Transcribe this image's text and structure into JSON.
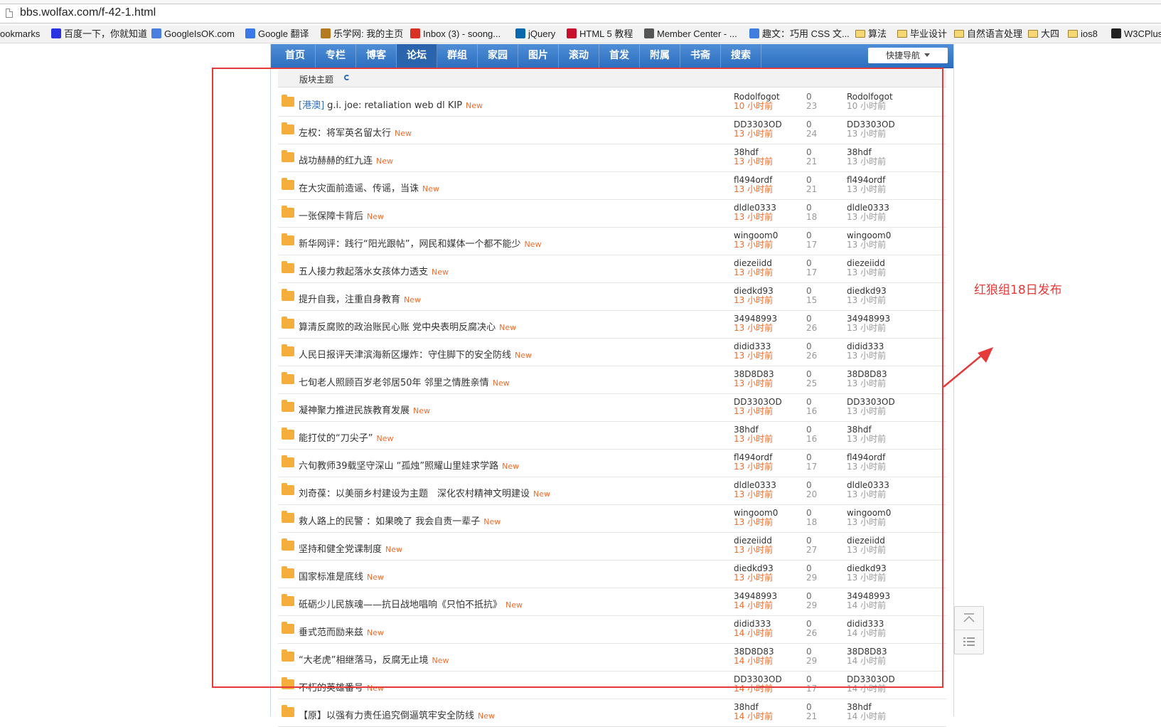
{
  "browser": {
    "url": "bbs.wolfax.com/f-42-1.html"
  },
  "bookmarks": [
    {
      "label": "ookmarks",
      "icon": "none"
    },
    {
      "label": "百度一下，你就知道",
      "icon": "baidu-paw-icon",
      "color": "#2932e1"
    },
    {
      "label": "GoogleIsOK.com",
      "icon": "google-icon",
      "color": "#4a7fe0"
    },
    {
      "label": "Google 翻译",
      "icon": "translate-icon",
      "color": "#3b78e7"
    },
    {
      "label": "乐学网: 我的主页",
      "icon": "lexue-icon",
      "color": "#b47a1f"
    },
    {
      "label": "Inbox (3) - soong...",
      "icon": "gmail-icon",
      "color": "#d93025"
    },
    {
      "label": "jQuery",
      "icon": "jquery-icon",
      "color": "#0769ad"
    },
    {
      "label": "HTML 5 教程",
      "icon": "w3school-icon",
      "color": "#c8102e"
    },
    {
      "label": "Member Center - ...",
      "icon": "apple-icon",
      "color": "#555555"
    },
    {
      "label": "趣文：巧用 CSS 文...",
      "icon": "bookmark-b-icon",
      "color": "#3d7ede"
    },
    {
      "label": "算法",
      "icon": "folder-icon"
    },
    {
      "label": "毕业设计",
      "icon": "folder-icon"
    },
    {
      "label": "自然语言处理",
      "icon": "folder-icon"
    },
    {
      "label": "大四",
      "icon": "folder-icon"
    },
    {
      "label": "ios8",
      "icon": "folder-icon"
    },
    {
      "label": "W3CPlus",
      "icon": "w3cplus-icon",
      "color": "#222222"
    }
  ],
  "nav": {
    "items": [
      "首页",
      "专栏",
      "博客",
      "论坛",
      "群组",
      "家园",
      "图片",
      "滚动",
      "首发",
      "附属",
      "书斋",
      "搜索"
    ],
    "active_index": 3,
    "quick_nav": "快捷导航"
  },
  "section": {
    "header": "版块主题"
  },
  "threads": [
    {
      "tag": "[港澳]",
      "title": "g.i. joe: retaliation web dl KIP",
      "new": "New",
      "author": "Rodolfogot",
      "posted": "10 小时前",
      "replies": "0",
      "views": "23",
      "last_user": "Rodolfogot",
      "last_time": "10 小时前"
    },
    {
      "tag": "",
      "title": "左权：将军英名留太行",
      "new": "New",
      "author": "DD3303OD",
      "posted": "13 小时前",
      "replies": "0",
      "views": "24",
      "last_user": "DD3303OD",
      "last_time": "13 小时前"
    },
    {
      "tag": "",
      "title": "战功赫赫的红九连",
      "new": "New",
      "author": "38hdf",
      "posted": "13 小时前",
      "replies": "0",
      "views": "21",
      "last_user": "38hdf",
      "last_time": "13 小时前"
    },
    {
      "tag": "",
      "title": "在大灾面前造谣、传谣，当诛",
      "new": "New",
      "author": "fl494ordf",
      "posted": "13 小时前",
      "replies": "0",
      "views": "21",
      "last_user": "fl494ordf",
      "last_time": "13 小时前"
    },
    {
      "tag": "",
      "title": "一张保障卡背后",
      "new": "New",
      "author": "dldle0333",
      "posted": "13 小时前",
      "replies": "0",
      "views": "18",
      "last_user": "dldle0333",
      "last_time": "13 小时前"
    },
    {
      "tag": "",
      "title": "新华网评：践行“阳光跟帖”，网民和媒体一个都不能少",
      "new": "New",
      "author": "wingoom0",
      "posted": "13 小时前",
      "replies": "0",
      "views": "17",
      "last_user": "wingoom0",
      "last_time": "13 小时前"
    },
    {
      "tag": "",
      "title": "五人接力救起落水女孩体力透支",
      "new": "New",
      "author": "diezeiidd",
      "posted": "13 小时前",
      "replies": "0",
      "views": "17",
      "last_user": "diezeiidd",
      "last_time": "13 小时前"
    },
    {
      "tag": "",
      "title": "提升自我，注重自身教育",
      "new": "New",
      "author": "diedkd93",
      "posted": "13 小时前",
      "replies": "0",
      "views": "15",
      "last_user": "diedkd93",
      "last_time": "13 小时前"
    },
    {
      "tag": "",
      "title": "算清反腐败的政治账民心账 党中央表明反腐决心",
      "new": "New",
      "author": "34948993",
      "posted": "13 小时前",
      "replies": "0",
      "views": "26",
      "last_user": "34948993",
      "last_time": "13 小时前"
    },
    {
      "tag": "",
      "title": "人民日报评天津滨海新区爆炸：守住脚下的安全防线",
      "new": "New",
      "author": "didid333",
      "posted": "13 小时前",
      "replies": "0",
      "views": "26",
      "last_user": "didid333",
      "last_time": "13 小时前"
    },
    {
      "tag": "",
      "title": "七旬老人照顾百岁老邻居50年 邻里之情胜亲情",
      "new": "New",
      "author": "38D8D83",
      "posted": "13 小时前",
      "replies": "0",
      "views": "25",
      "last_user": "38D8D83",
      "last_time": "13 小时前"
    },
    {
      "tag": "",
      "title": "凝神聚力推进民族教育发展",
      "new": "New",
      "author": "DD3303OD",
      "posted": "13 小时前",
      "replies": "0",
      "views": "16",
      "last_user": "DD3303OD",
      "last_time": "13 小时前"
    },
    {
      "tag": "",
      "title": "能打仗的“刀尖子”",
      "new": "New",
      "author": "38hdf",
      "posted": "13 小时前",
      "replies": "0",
      "views": "16",
      "last_user": "38hdf",
      "last_time": "13 小时前"
    },
    {
      "tag": "",
      "title": "六旬教师39载坚守深山 “孤烛”照耀山里娃求学路",
      "new": "New",
      "author": "fl494ordf",
      "posted": "13 小时前",
      "replies": "0",
      "views": "17",
      "last_user": "fl494ordf",
      "last_time": "13 小时前"
    },
    {
      "tag": "",
      "title": "刘奇葆：以美丽乡村建设为主题　深化农村精神文明建设",
      "new": "New",
      "author": "dldle0333",
      "posted": "13 小时前",
      "replies": "0",
      "views": "20",
      "last_user": "dldle0333",
      "last_time": "13 小时前"
    },
    {
      "tag": "",
      "title": "救人路上的民警 ：如果晚了 我会自责一辈子",
      "new": "New",
      "author": "wingoom0",
      "posted": "13 小时前",
      "replies": "0",
      "views": "18",
      "last_user": "wingoom0",
      "last_time": "13 小时前"
    },
    {
      "tag": "",
      "title": "坚持和健全党课制度",
      "new": "New",
      "author": "diezeiidd",
      "posted": "13 小时前",
      "replies": "0",
      "views": "27",
      "last_user": "diezeiidd",
      "last_time": "13 小时前"
    },
    {
      "tag": "",
      "title": "国家标准是底线",
      "new": "New",
      "author": "diedkd93",
      "posted": "13 小时前",
      "replies": "0",
      "views": "29",
      "last_user": "diedkd93",
      "last_time": "13 小时前"
    },
    {
      "tag": "",
      "title": "砥砺少儿民族魂——抗日战地唱响《只怕不抵抗》",
      "new": "New",
      "author": "34948993",
      "posted": "14 小时前",
      "replies": "0",
      "views": "29",
      "last_user": "34948993",
      "last_time": "14 小时前"
    },
    {
      "tag": "",
      "title": "垂式范而励来兹",
      "new": "New",
      "author": "didid333",
      "posted": "14 小时前",
      "replies": "0",
      "views": "26",
      "last_user": "didid333",
      "last_time": "14 小时前"
    },
    {
      "tag": "",
      "title": "“大老虎”相继落马，反腐无止境",
      "new": "New",
      "author": "38D8D83",
      "posted": "14 小时前",
      "replies": "0",
      "views": "29",
      "last_user": "38D8D83",
      "last_time": "14 小时前"
    },
    {
      "tag": "",
      "title": "不朽的英雄番号",
      "new": "New",
      "author": "DD3303OD",
      "posted": "14 小时前",
      "replies": "0",
      "views": "17",
      "last_user": "DD3303OD",
      "last_time": "14 小时前"
    },
    {
      "tag": "",
      "title": "【原】以强有力责任追究倒逼筑牢安全防线",
      "new": "New",
      "author": "38hdf",
      "posted": "14 小时前",
      "replies": "0",
      "views": "21",
      "last_user": "38hdf",
      "last_time": "14 小时前"
    }
  ],
  "annotation": {
    "note": "红狼组18日发布",
    "color": "#e53a3a"
  },
  "colors": {
    "nav_blue": "#2c6ec0",
    "new_orange": "#f06c2b",
    "folder_orange": "#f5ad3b"
  }
}
